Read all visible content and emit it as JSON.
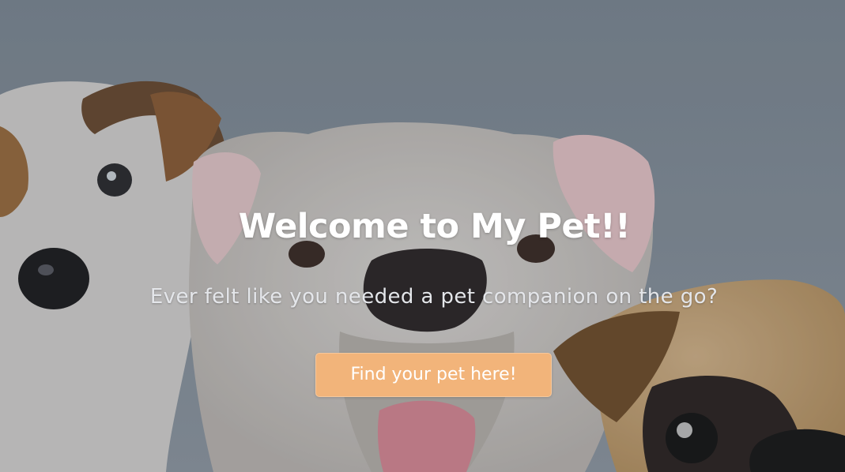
{
  "hero": {
    "title": "Welcome to My Pet!!",
    "subtitle": "Ever felt like you needed a pet companion on the go?",
    "cta_label": "Find your pet here!",
    "background_image": "puppies-photo",
    "colors": {
      "background": "#7f8b98",
      "title": "#ffffff",
      "subtitle": "#e4e6ea",
      "button": "#f2b47a",
      "button_text": "#ffffff"
    }
  }
}
